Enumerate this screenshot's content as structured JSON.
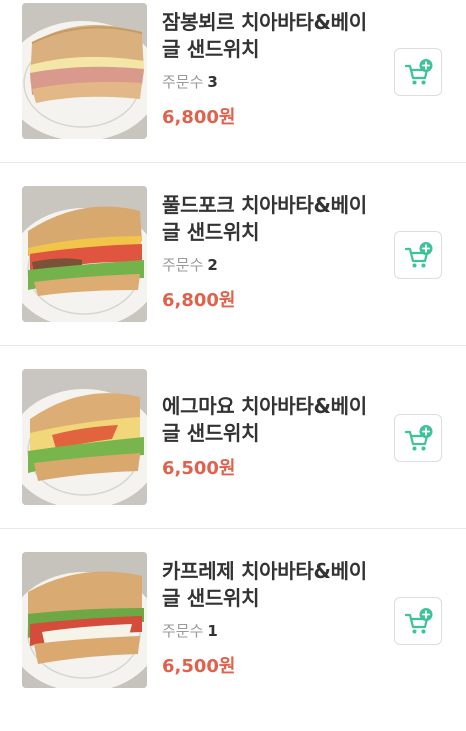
{
  "products": [
    {
      "name_line1": "잠봉뵈르 치아바타&베이",
      "name_line2": "글 샌드위치",
      "orders_label": "주문수",
      "orders_count": "3",
      "price": "6,800원",
      "image": "sandwich-jambon-beurre"
    },
    {
      "name_line1": "풀드포크 치아바타&베이",
      "name_line2": "글 샌드위치",
      "orders_label": "주문수",
      "orders_count": "2",
      "price": "6,800원",
      "image": "sandwich-pulled-pork"
    },
    {
      "name_line1": "에그마요 치아바타&베이",
      "name_line2": "글 샌드위치",
      "orders_label": "",
      "orders_count": "",
      "price": "6,500원",
      "image": "sandwich-egg-mayo"
    },
    {
      "name_line1": "카프레제 치아바타&베이",
      "name_line2": "글 샌드위치",
      "orders_label": "주문수",
      "orders_count": "1",
      "price": "6,500원",
      "image": "sandwich-caprese"
    }
  ],
  "colors": {
    "price": "#e0624d",
    "cart_icon": "#3dc39a",
    "name": "#333333",
    "orders_label": "#9a9a9a"
  },
  "icons": {
    "cart_button": "cart-plus-icon"
  }
}
